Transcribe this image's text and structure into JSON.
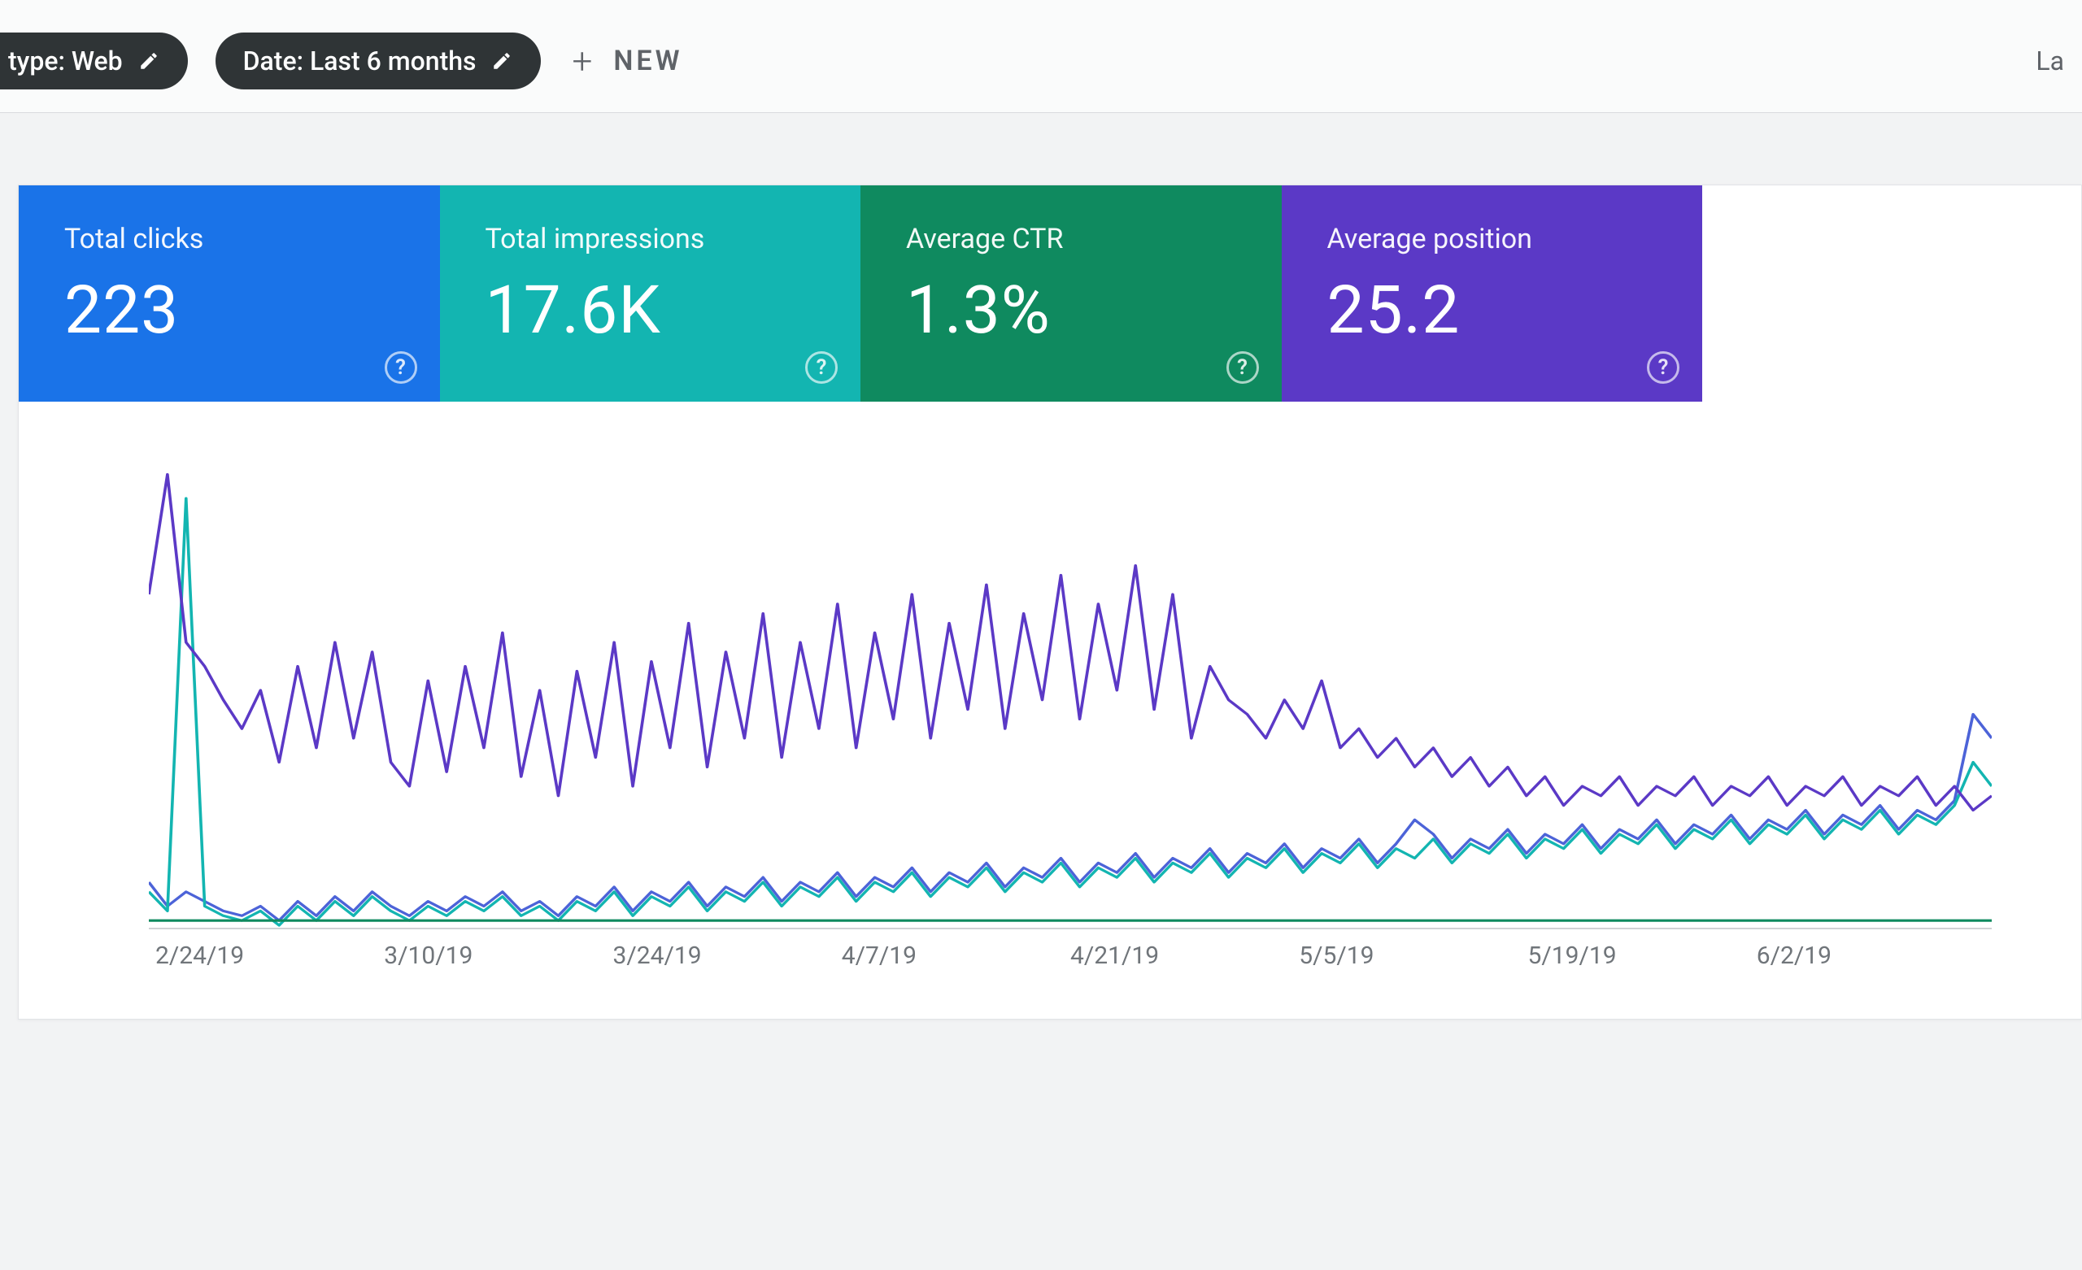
{
  "filters": {
    "search_type": {
      "prefix": "type:",
      "value": "Web"
    },
    "date": {
      "prefix": "Date:",
      "value": "Last 6 months"
    },
    "new_label": "NEW"
  },
  "last_updated_label": "La",
  "stats": {
    "clicks": {
      "label": "Total clicks",
      "value": "223"
    },
    "impressions": {
      "label": "Total impressions",
      "value": "17.6K"
    },
    "ctr": {
      "label": "Average CTR",
      "value": "1.3%"
    },
    "position": {
      "label": "Average position",
      "value": "25.2"
    }
  },
  "chart_data": {
    "type": "line",
    "xlabel": "",
    "ylabel": "",
    "x_ticks": [
      "2/24/19",
      "3/10/19",
      "3/24/19",
      "4/7/19",
      "4/21/19",
      "5/5/19",
      "5/19/19",
      "6/2/19"
    ],
    "ylim": [
      0,
      100
    ],
    "series": [
      {
        "name": "Clicks",
        "color": "#4c63d8",
        "values": [
          10,
          5,
          8,
          6,
          4,
          3,
          5,
          2,
          6,
          3,
          7,
          4,
          8,
          5,
          3,
          6,
          4,
          7,
          5,
          8,
          4,
          6,
          3,
          7,
          5,
          9,
          4,
          8,
          6,
          10,
          5,
          9,
          7,
          11,
          6,
          10,
          8,
          12,
          7,
          11,
          9,
          13,
          8,
          12,
          10,
          14,
          9,
          13,
          11,
          15,
          10,
          14,
          12,
          16,
          11,
          15,
          13,
          17,
          12,
          16,
          14,
          18,
          13,
          17,
          15,
          19,
          14,
          18,
          23,
          20,
          15,
          19,
          17,
          21,
          16,
          20,
          18,
          22,
          17,
          21,
          19,
          23,
          18,
          22,
          20,
          24,
          19,
          23,
          21,
          25,
          20,
          24,
          22,
          26,
          21,
          25,
          23,
          27,
          45,
          40
        ]
      },
      {
        "name": "Impressions",
        "color": "#13b5b1",
        "values": [
          8,
          4,
          90,
          5,
          3,
          2,
          4,
          1,
          5,
          2,
          6,
          3,
          7,
          4,
          2,
          5,
          3,
          6,
          4,
          7,
          3,
          5,
          2,
          6,
          4,
          8,
          3,
          7,
          5,
          9,
          4,
          8,
          6,
          10,
          5,
          9,
          7,
          11,
          6,
          10,
          8,
          12,
          7,
          11,
          9,
          13,
          8,
          12,
          10,
          14,
          9,
          13,
          11,
          15,
          10,
          14,
          12,
          16,
          11,
          15,
          13,
          17,
          12,
          16,
          14,
          18,
          13,
          17,
          15,
          19,
          14,
          18,
          16,
          20,
          15,
          19,
          17,
          21,
          16,
          20,
          18,
          22,
          17,
          21,
          19,
          23,
          18,
          22,
          20,
          24,
          19,
          23,
          21,
          25,
          20,
          24,
          22,
          26,
          35,
          30
        ]
      },
      {
        "name": "CTR",
        "color": "#0f8a5f",
        "values": [
          2,
          2,
          2,
          2,
          2,
          2,
          2,
          2,
          2,
          2,
          2,
          2,
          2,
          2,
          2,
          2,
          2,
          2,
          2,
          2,
          2,
          2,
          2,
          2,
          2,
          2,
          2,
          2,
          2,
          2,
          2,
          2,
          2,
          2,
          2,
          2,
          2,
          2,
          2,
          2,
          2,
          2,
          2,
          2,
          2,
          2,
          2,
          2,
          2,
          2,
          2,
          2,
          2,
          2,
          2,
          2,
          2,
          2,
          2,
          2,
          2,
          2,
          2,
          2,
          2,
          2,
          2,
          2,
          2,
          2,
          2,
          2,
          2,
          2,
          2,
          2,
          2,
          2,
          2,
          2,
          2,
          2,
          2,
          2,
          2,
          2,
          2,
          2,
          2,
          2,
          2,
          2,
          2,
          2,
          2,
          2,
          2,
          2,
          2,
          2
        ]
      },
      {
        "name": "Position",
        "color": "#5b39c6",
        "values": [
          70,
          95,
          60,
          55,
          48,
          42,
          50,
          35,
          55,
          38,
          60,
          40,
          58,
          35,
          30,
          52,
          33,
          55,
          38,
          62,
          32,
          50,
          28,
          54,
          36,
          60,
          30,
          56,
          38,
          64,
          34,
          58,
          40,
          66,
          36,
          60,
          42,
          68,
          38,
          62,
          44,
          70,
          40,
          64,
          46,
          72,
          42,
          66,
          48,
          74,
          44,
          68,
          50,
          76,
          46,
          70,
          40,
          55,
          48,
          45,
          40,
          48,
          42,
          52,
          38,
          42,
          36,
          40,
          34,
          38,
          32,
          36,
          30,
          34,
          28,
          32,
          26,
          30,
          28,
          32,
          26,
          30,
          28,
          32,
          26,
          30,
          28,
          32,
          26,
          30,
          28,
          32,
          26,
          30,
          28,
          32,
          26,
          30,
          25,
          28
        ]
      }
    ]
  }
}
